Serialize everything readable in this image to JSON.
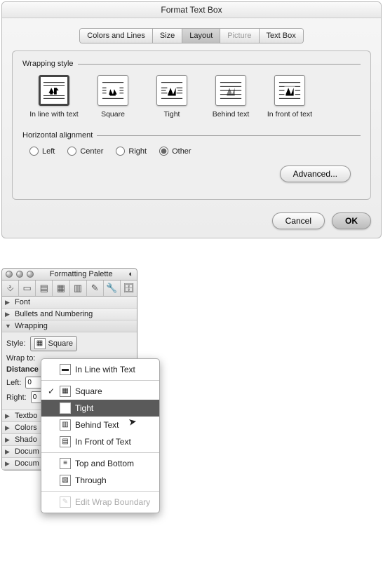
{
  "dialog": {
    "title": "Format Text Box",
    "tabs": {
      "colors": "Colors and Lines",
      "size": "Size",
      "layout": "Layout",
      "picture": "Picture",
      "textbox": "Text Box"
    },
    "wrapping_label": "Wrapping style",
    "wrap_opts": {
      "inline": "In line with text",
      "square": "Square",
      "tight": "Tight",
      "behind": "Behind text",
      "infront": "In front of text"
    },
    "halign_label": "Horizontal alignment",
    "halign": {
      "left": "Left",
      "center": "Center",
      "right": "Right",
      "other": "Other"
    },
    "buttons": {
      "advanced": "Advanced...",
      "cancel": "Cancel",
      "ok": "OK"
    }
  },
  "palette": {
    "title": "Formatting Palette",
    "rows": {
      "font": "Font",
      "bullets": "Bullets and Numbering",
      "wrapping": "Wrapping",
      "textbox": "Textbo",
      "colors": "Colors",
      "shadow": "Shado",
      "doc1": "Docum",
      "doc2": "Docum"
    },
    "wrap": {
      "style_label": "Style:",
      "style_value": "Square",
      "wrapto_label": "Wrap to:",
      "distance_label": "Distance",
      "left_label": "Left:",
      "left_value": "0",
      "right_label": "Right:",
      "right_value": "0"
    },
    "menu": {
      "inline": "In Line with Text",
      "square": "Square",
      "tight": "Tight",
      "behind": "Behind Text",
      "infront": "In Front of Text",
      "topbottom": "Top and Bottom",
      "through": "Through",
      "editwrap": "Edit Wrap Boundary"
    }
  }
}
